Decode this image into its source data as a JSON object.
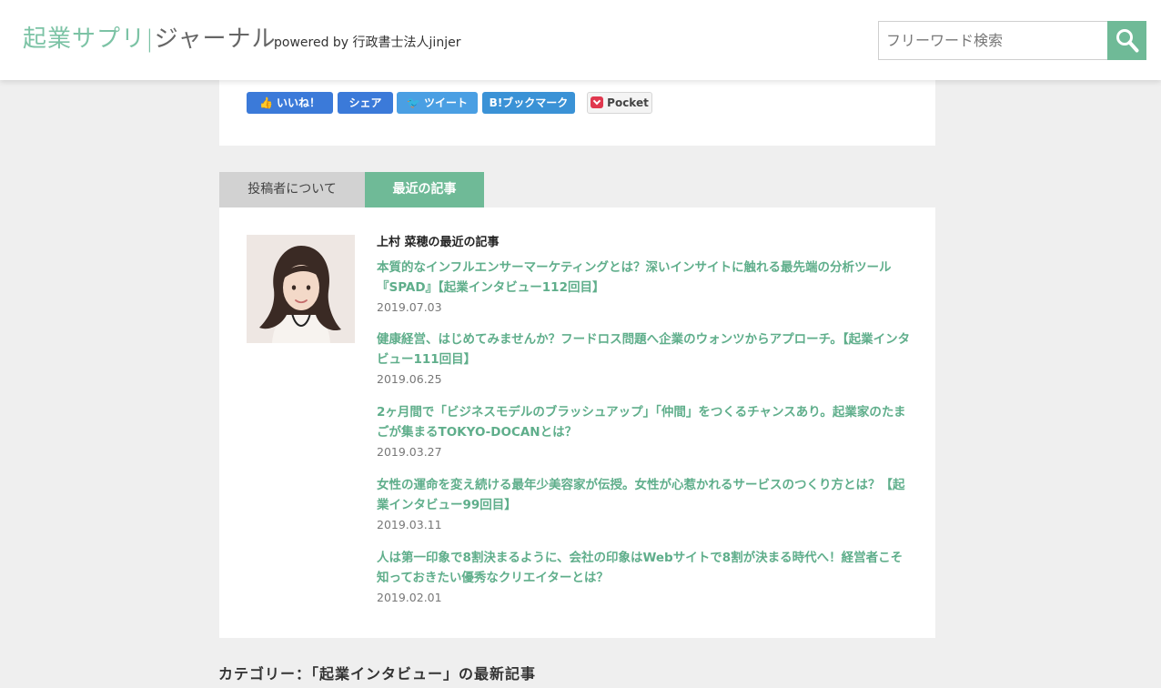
{
  "header": {
    "logo_part1": "起業サプリ",
    "logo_separator": "|",
    "logo_part2": "ジャーナル",
    "powered_by": "powered by 行政書士法人jinjer",
    "search_placeholder": "フリーワード検索",
    "accent_color": "#6fba97"
  },
  "share": {
    "like": "いいね！",
    "share": "シェア",
    "tweet": "ツイート",
    "bookmark": "ブックマーク",
    "bookmark_badge": "B!",
    "pocket": "Pocket"
  },
  "tabs": {
    "author": "投稿者について",
    "recent": "最近の記事"
  },
  "recent": {
    "heading": "上村 菜穂の最近の記事",
    "articles": [
      {
        "title": "本質的なインフルエンサーマーケティングとは？深いインサイトに触れる最先端の分析ツール『SPAD』【起業インタビュー112回目】",
        "date": "2019.07.03"
      },
      {
        "title": "健康経営、はじめてみませんか？フードロス問題へ企業のウォンツからアプローチ。【起業インタビュー111回目】",
        "date": "2019.06.25"
      },
      {
        "title": "2ヶ月間で「ビジネスモデルのブラッシュアップ」「仲間」をつくるチャンスあり。起業家のたまごが集まるTOKYO-DOCANとは？",
        "date": "2019.03.27"
      },
      {
        "title": "女性の運命を変え続ける最年少美容家が伝授。女性が心惹かれるサービスのつくり方とは？【起業インタビュー99回目】",
        "date": "2019.03.11"
      },
      {
        "title": "人は第一印象で8割決まるように、会社の印象はWebサイトで8割が決まる時代へ！経営者こそ知っておきたい優秀なクリエイターとは？",
        "date": "2019.02.01"
      }
    ]
  },
  "category_heading": "カテゴリー：「起業インタビュー」の最新記事"
}
